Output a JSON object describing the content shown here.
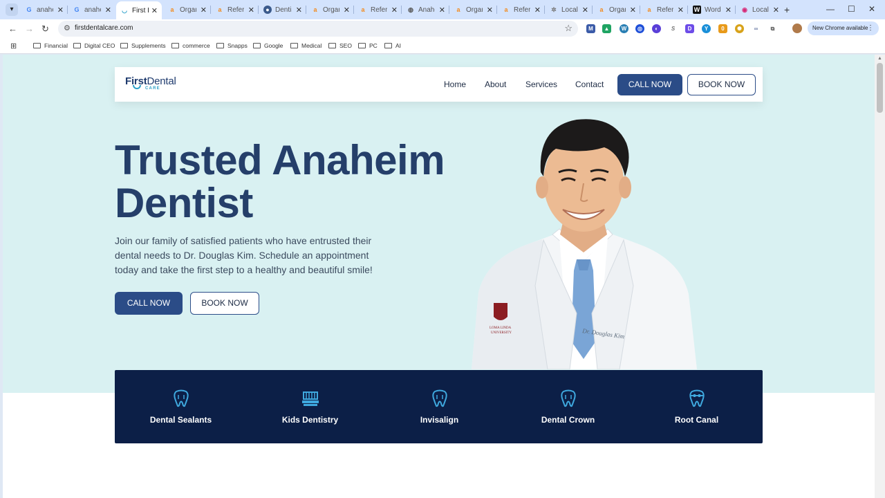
{
  "browser": {
    "tabs": [
      {
        "label": "anahe",
        "icon": "google-icon",
        "color": "#4285f4"
      },
      {
        "label": "anahe",
        "icon": "google-icon",
        "color": "#4285f4"
      },
      {
        "label": "First D",
        "icon": "first-dental-icon",
        "color": "#2a9fc9",
        "active": true
      },
      {
        "label": "Organ",
        "icon": "ahrefs-icon",
        "color": "#f28b20"
      },
      {
        "label": "Refer",
        "icon": "ahrefs-icon",
        "color": "#f28b20"
      },
      {
        "label": "Dentis",
        "icon": "globe-icon",
        "color": "#3a5a8c"
      },
      {
        "label": "Organ",
        "icon": "ahrefs-icon",
        "color": "#f28b20"
      },
      {
        "label": "Refer",
        "icon": "ahrefs-icon",
        "color": "#f28b20"
      },
      {
        "label": "Anahe",
        "icon": "globe-icon",
        "color": "#555555"
      },
      {
        "label": "Organ",
        "icon": "ahrefs-icon",
        "color": "#f28b20"
      },
      {
        "label": "Refer",
        "icon": "ahrefs-icon",
        "color": "#f28b20"
      },
      {
        "label": "Local",
        "icon": "gear-icon",
        "color": "#777777"
      },
      {
        "label": "Organ",
        "icon": "ahrefs-icon",
        "color": "#f28b20"
      },
      {
        "label": "Refer",
        "icon": "ahrefs-icon",
        "color": "#f28b20"
      },
      {
        "label": "Word",
        "icon": "wordhero-icon",
        "color": "#111111"
      },
      {
        "label": "Local",
        "icon": "instagram-icon",
        "color": "#d62976"
      }
    ],
    "url": "firstdentalcare.com",
    "update_chip": "New Chrome available",
    "extensions": [
      {
        "name": "mail-ext-icon",
        "color": "#3b5ba8",
        "glyph": "M"
      },
      {
        "name": "drive-ext-icon",
        "color": "#1fa463",
        "glyph": "▲"
      },
      {
        "name": "wp-ext-icon",
        "color": "#2a7fb4",
        "glyph": "W"
      },
      {
        "name": "similarweb-ext-icon",
        "color": "#1e4fd8",
        "glyph": "◎"
      },
      {
        "name": "semrush-ext-icon",
        "color": "#5a3fd8",
        "glyph": "◐"
      },
      {
        "name": "s-ext-icon",
        "color": "#888888",
        "glyph": "S"
      },
      {
        "name": "d-ext-icon",
        "color": "#6d4ce8",
        "glyph": "D"
      },
      {
        "name": "yoast-ext-icon",
        "color": "#1a8fd8",
        "glyph": "Y"
      },
      {
        "name": "badge-ext-icon",
        "color": "#e89a1a",
        "glyph": "0"
      },
      {
        "name": "sun-ext-icon",
        "color": "#d8a21a",
        "glyph": "✺"
      },
      {
        "name": "link-ext-icon",
        "color": "#6f7fa8",
        "glyph": "∞"
      },
      {
        "name": "puzzle-ext-icon",
        "color": "#555555",
        "glyph": "⧉"
      }
    ],
    "bookmarks": [
      "Financial",
      "Digital CEO",
      "Supplements",
      "commerce",
      "Snapps",
      "Google",
      "Medical",
      "SEO",
      "PC",
      "AI"
    ]
  },
  "site": {
    "logo": {
      "first": "First",
      "dental": "Dental",
      "care": "CARE"
    },
    "nav": [
      "Home",
      "About",
      "Services",
      "Contact"
    ],
    "call_label": "CALL NOW",
    "book_label": "BOOK NOW",
    "hero": {
      "title_line1": "Trusted Anaheim",
      "title_line2": "Dentist",
      "text": "Join our family of satisfied patients who have entrusted their dental needs to Dr. Douglas Kim. Schedule an appointment today and take the first step to a healthy and beautiful smile!",
      "cta_call": "CALL NOW",
      "cta_book": "BOOK NOW",
      "coat_name": "Dr. Douglas Kim"
    },
    "services": [
      {
        "label": "Dental Sealants",
        "icon": "tooth-icon"
      },
      {
        "label": "Kids Dentistry",
        "icon": "toothbrush-icon"
      },
      {
        "label": "Invisalign",
        "icon": "tooth-icon"
      },
      {
        "label": "Dental Crown",
        "icon": "tooth-icon"
      },
      {
        "label": "Root Canal",
        "icon": "tooth-braces-icon"
      }
    ]
  },
  "colors": {
    "hero_bg": "#d9f1f2",
    "navy": "#0c1f47",
    "primary": "#2b4c87",
    "accent": "#2a9fc9",
    "title": "#253f6a"
  }
}
